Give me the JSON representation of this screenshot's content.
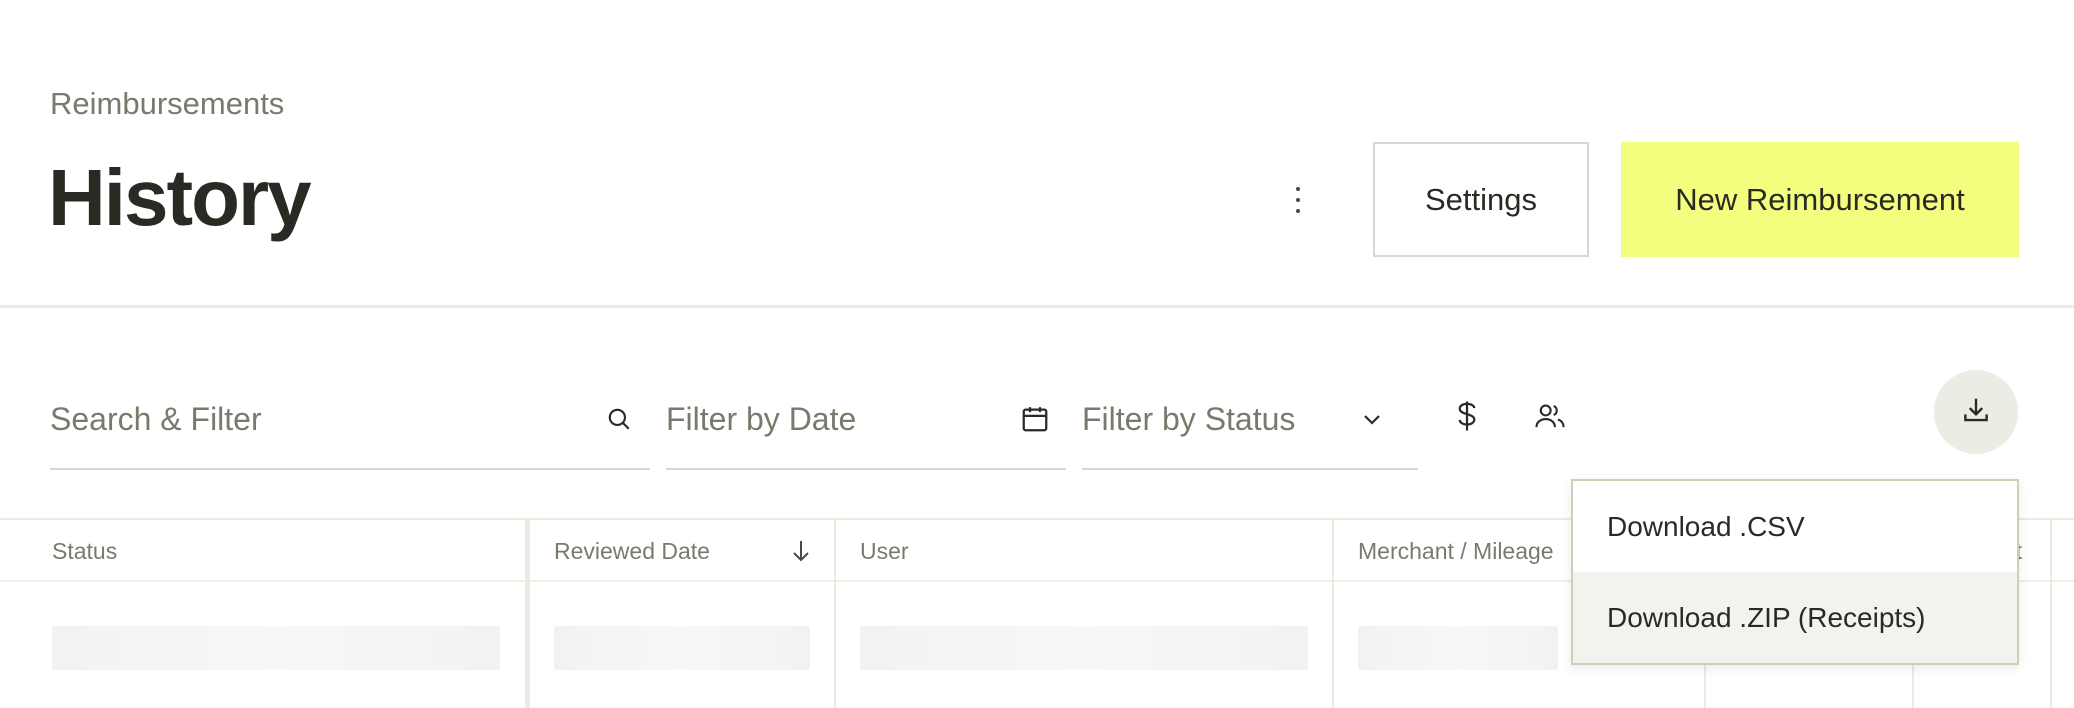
{
  "header": {
    "breadcrumb": "Reimbursements",
    "title": "History",
    "settings_label": "Settings",
    "new_label": "New Reimbursement",
    "more_icon": "kebab-vertical-icon"
  },
  "filters": {
    "search_placeholder": "Search & Filter",
    "date_placeholder": "Filter by Date",
    "status_placeholder": "Filter by Status",
    "icons": [
      "search-icon",
      "calendar-icon",
      "chevron-down-icon",
      "dollar-icon",
      "users-icon",
      "download-icon"
    ]
  },
  "table": {
    "columns": [
      {
        "label": "Status"
      },
      {
        "label": "Reviewed Date",
        "sort": "descending"
      },
      {
        "label": "User"
      },
      {
        "label": "Merchant / Mileage"
      },
      {
        "label": ""
      },
      {
        "label": "t"
      }
    ]
  },
  "download_menu": {
    "items": [
      {
        "label": "Download .CSV",
        "highlighted": false
      },
      {
        "label": "Download .ZIP (Receipts)",
        "highlighted": true
      }
    ]
  },
  "colors": {
    "accent": "#f3fd7e",
    "text": "#2a2a25",
    "muted": "#7a7a6c",
    "border": "#d8d8cc"
  }
}
